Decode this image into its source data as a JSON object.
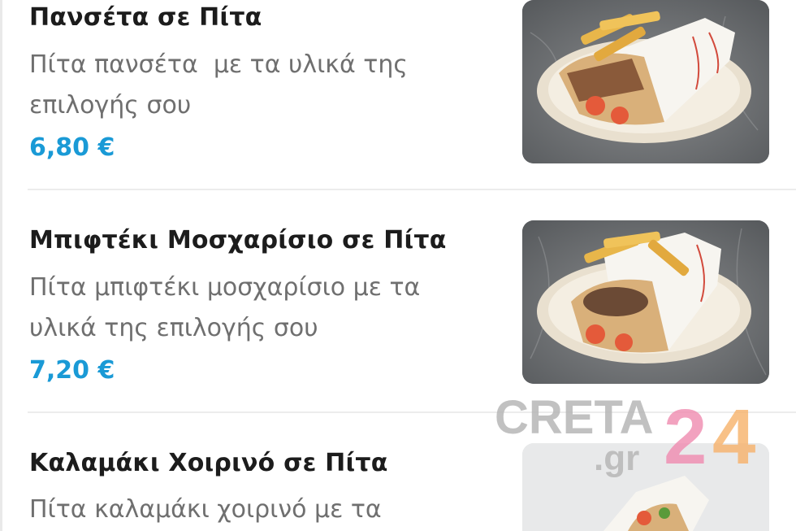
{
  "items": [
    {
      "title": "Πανσέτα σε Πίτα",
      "description": "Πίτα πανσέτα  με τα υλικά της επιλογής σου",
      "price": "6,80 €",
      "image": "pita-wrap-photo"
    },
    {
      "title": "Μπιφτέκι Μοσχαρίσιο σε Πίτα",
      "description": "Πίτα μπιφτέκι μοσχαρίσιο με τα υλικά της επιλογής σου",
      "price": "7,20 €",
      "image": "pita-wrap-photo"
    },
    {
      "title": "Καλαμάκι Χοιρινό σε Πίτα",
      "description": "Πίτα καλαμάκι χοιρινό με τα",
      "price": "",
      "image": "pita-wrap-photo"
    }
  ],
  "watermark": {
    "word": "CRETA",
    "domain": ".gr",
    "number": "24"
  },
  "colors": {
    "price": "#1a9ad6",
    "title": "#1c1c1c",
    "description": "#6f6f6f",
    "watermark_gray": "#b7b7b7",
    "watermark_pink": "#f08bb0",
    "watermark_orange": "#f7b26a"
  }
}
